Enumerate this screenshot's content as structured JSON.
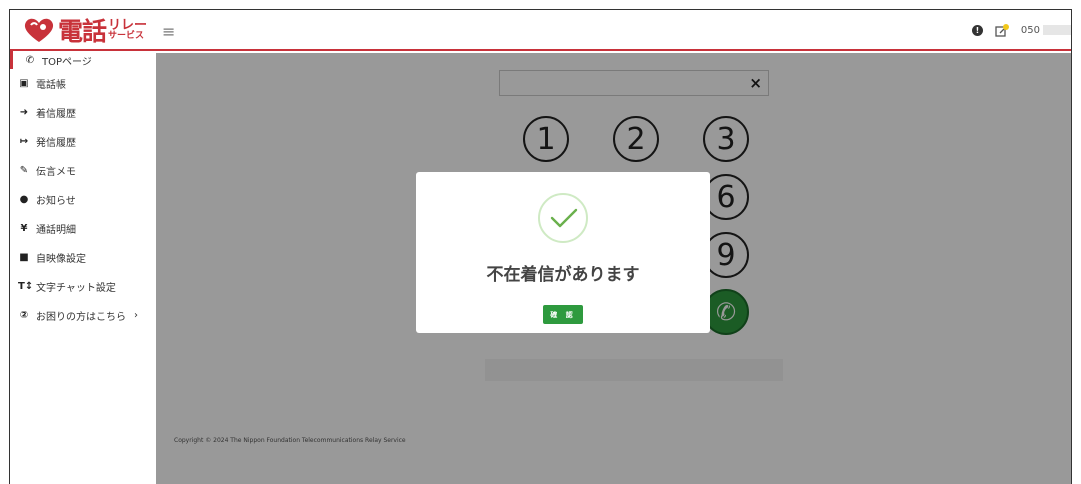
{
  "header": {
    "logo_main": "電話",
    "logo_sub_top": "リレー",
    "logo_sub_bottom": "サービス",
    "menu_icon": "hamburger-icon",
    "info_icon": "info-icon",
    "memo_icon": "memo-icon",
    "phone_number_prefix": "050"
  },
  "sidebar": {
    "items": [
      {
        "icon": "phone-icon",
        "glyph": "✆",
        "label": "TOPページ"
      },
      {
        "icon": "address-book-icon",
        "glyph": "▣",
        "label": "電話帳"
      },
      {
        "icon": "incoming-icon",
        "glyph": "➜",
        "label": "着信履歴"
      },
      {
        "icon": "outgoing-icon",
        "glyph": "↦",
        "label": "発信履歴"
      },
      {
        "icon": "memo-icon",
        "glyph": "✎",
        "label": "伝言メモ"
      },
      {
        "icon": "info-icon",
        "glyph": "●",
        "label": "お知らせ"
      },
      {
        "icon": "yen-icon",
        "glyph": "¥",
        "label": "通話明細"
      },
      {
        "icon": "video-icon",
        "glyph": "■",
        "label": "自映像設定"
      },
      {
        "icon": "text-size-icon",
        "glyph": "T↕",
        "label": "文字チャット設定"
      },
      {
        "icon": "help-icon",
        "glyph": "②",
        "label": "お困りの方はこちら"
      }
    ],
    "help_chevron": "›"
  },
  "dialer": {
    "clear_label": "×",
    "keys": [
      "1",
      "2",
      "3",
      "6",
      "9"
    ],
    "call_glyph": "✆"
  },
  "footer": {
    "copyright": "Copyright © 2024 The Nippon Foundation Telecommunications Relay Service"
  },
  "modal": {
    "message": "不在着信があります",
    "ok_label": "確 認"
  },
  "colors": {
    "brand_red": "#c8323a",
    "call_green": "#2e9a3e",
    "check_green": "#6ab04c"
  }
}
